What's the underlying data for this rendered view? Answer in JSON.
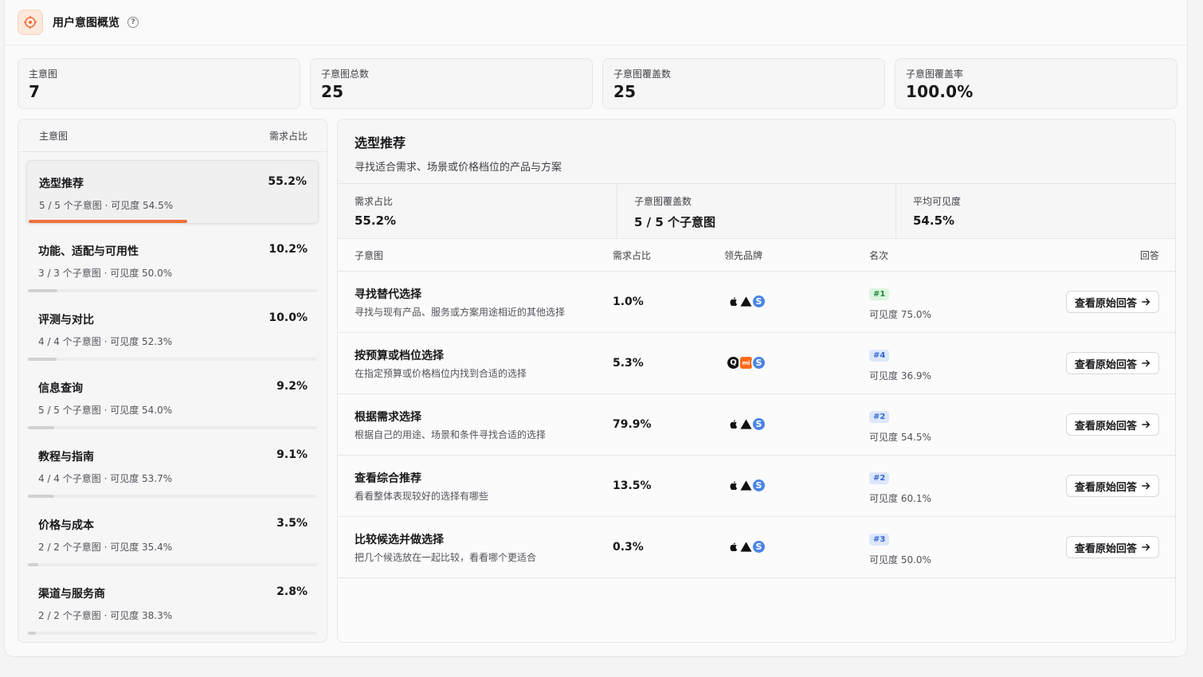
{
  "header": {
    "title": "用户意图概览"
  },
  "stats": [
    {
      "label": "主意图",
      "value": "7"
    },
    {
      "label": "子意图总数",
      "value": "25"
    },
    {
      "label": "子意图覆盖数",
      "value": "25"
    },
    {
      "label": "子意图覆盖率",
      "value": "100.0%"
    }
  ],
  "left_panel": {
    "col_intent": "主意图",
    "col_share": "需求占比",
    "intents": [
      {
        "name": "选型推荐",
        "share": "55.2%",
        "meta": "5 / 5 个子意图 · 可见度 54.5%",
        "bar": 0.552
      },
      {
        "name": "功能、适配与可用性",
        "share": "10.2%",
        "meta": "3 / 3 个子意图 · 可见度 50.0%",
        "bar": 0.102
      },
      {
        "name": "评测与对比",
        "share": "10.0%",
        "meta": "4 / 4 个子意图 · 可见度 52.3%",
        "bar": 0.1
      },
      {
        "name": "信息查询",
        "share": "9.2%",
        "meta": "5 / 5 个子意图 · 可见度 54.0%",
        "bar": 0.092
      },
      {
        "name": "教程与指南",
        "share": "9.1%",
        "meta": "4 / 4 个子意图 · 可见度 53.7%",
        "bar": 0.091
      },
      {
        "name": "价格与成本",
        "share": "3.5%",
        "meta": "2 / 2 个子意图 · 可见度 35.4%",
        "bar": 0.035
      },
      {
        "name": "渠道与服务商",
        "share": "2.8%",
        "meta": "2 / 2 个子意图 · 可见度 38.3%",
        "bar": 0.028
      }
    ]
  },
  "detail": {
    "title": "选型推荐",
    "description": "寻找适合需求、场景或价格档位的产品与方案",
    "stats": [
      {
        "label": "需求占比",
        "value": "55.2%"
      },
      {
        "label": "子意图覆盖数",
        "value": "5 / 5 个子意图"
      },
      {
        "label": "平均可见度",
        "value": "54.5%"
      }
    ],
    "columns": {
      "sub": "子意图",
      "share": "需求占比",
      "brand": "领先品牌",
      "rank": "名次",
      "answer": "回答"
    },
    "answer_label": "查看原始回答",
    "rows": [
      {
        "name": "寻找替代选择",
        "desc": "寻找与现有产品、服务或方案用途相近的其他选择",
        "share": "1.0%",
        "brands": [
          "apple-icon",
          "triangle-icon",
          "s-icon"
        ],
        "rank": "#1",
        "rank_color": "green",
        "visibility": "可见度 75.0%"
      },
      {
        "name": "按预算或档位选择",
        "desc": "在指定预算或价格档位内找到合适的选择",
        "share": "5.3%",
        "brands": [
          "q-icon",
          "mi-icon",
          "s-icon"
        ],
        "rank": "#4",
        "rank_color": "blue",
        "visibility": "可见度 36.9%"
      },
      {
        "name": "根据需求选择",
        "desc": "根据自己的用途、场景和条件寻找合适的选择",
        "share": "79.9%",
        "brands": [
          "apple-icon",
          "triangle-icon",
          "s-icon"
        ],
        "rank": "#2",
        "rank_color": "blue",
        "visibility": "可见度 54.5%"
      },
      {
        "name": "查看综合推荐",
        "desc": "看看整体表现较好的选择有哪些",
        "share": "13.5%",
        "brands": [
          "apple-icon",
          "triangle-icon",
          "s-icon"
        ],
        "rank": "#2",
        "rank_color": "blue",
        "visibility": "可见度 60.1%"
      },
      {
        "name": "比较候选并做选择",
        "desc": "把几个候选放在一起比较，看看哪个更适合",
        "share": "0.3%",
        "brands": [
          "apple-icon",
          "triangle-icon",
          "s-icon"
        ],
        "rank": "#3",
        "rank_color": "blue",
        "visibility": "可见度 50.0%"
      }
    ]
  },
  "colors": {
    "accent": "#f0703c",
    "rank_green": "#1f8a3a",
    "rank_blue": "#3468d4",
    "brand_s": "#4a84e8"
  }
}
